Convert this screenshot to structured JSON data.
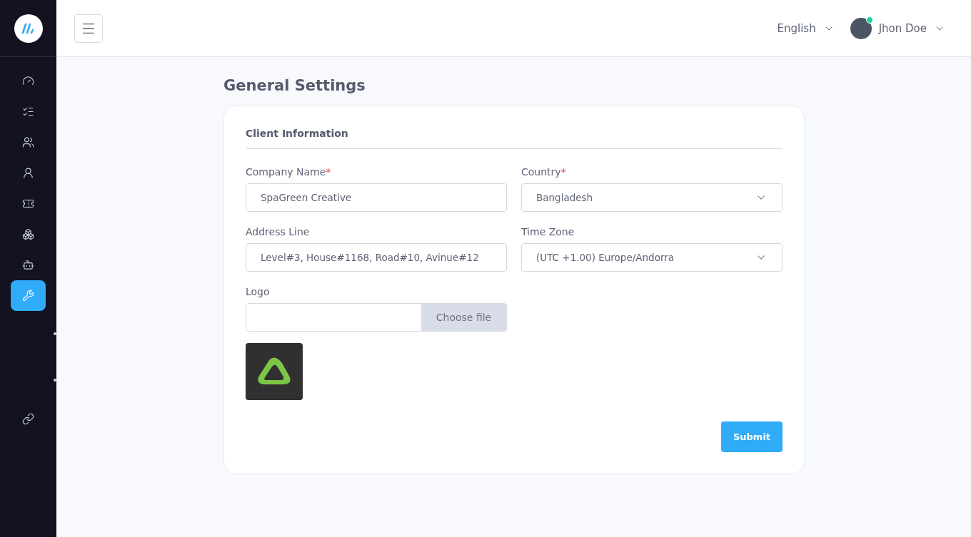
{
  "sidebar": {
    "items": [
      {
        "kind": "dashboard",
        "selected": false
      },
      {
        "kind": "tasks",
        "selected": false
      },
      {
        "kind": "team",
        "selected": false
      },
      {
        "kind": "user",
        "selected": false
      },
      {
        "kind": "ticket",
        "selected": false
      },
      {
        "kind": "modules",
        "selected": false
      },
      {
        "kind": "bot",
        "selected": false
      },
      {
        "kind": "tools",
        "selected": true
      },
      {
        "kind": "link",
        "selected": false
      }
    ]
  },
  "header": {
    "language": "English",
    "user": {
      "name": "Jhon Doe",
      "online": true
    }
  },
  "page_title": "General Settings",
  "card": {
    "section_title": "Client Information",
    "fields": [
      {
        "kind": "text",
        "label": "Company Name",
        "required_mark": "*",
        "value": "SpaGreen Creative"
      },
      {
        "kind": "select",
        "label": "Country",
        "required_mark": "*",
        "value": "Bangladesh"
      },
      {
        "kind": "text",
        "label": "Address Line",
        "value": "Level#3, House#1168, Road#10, Avinue#12"
      },
      {
        "kind": "select",
        "label": "Time Zone",
        "value": "(UTC +1.00) Europe/Andorra"
      },
      {
        "kind": "file",
        "label": "Logo",
        "button": "Choose file"
      }
    ],
    "submit": "Submit"
  }
}
